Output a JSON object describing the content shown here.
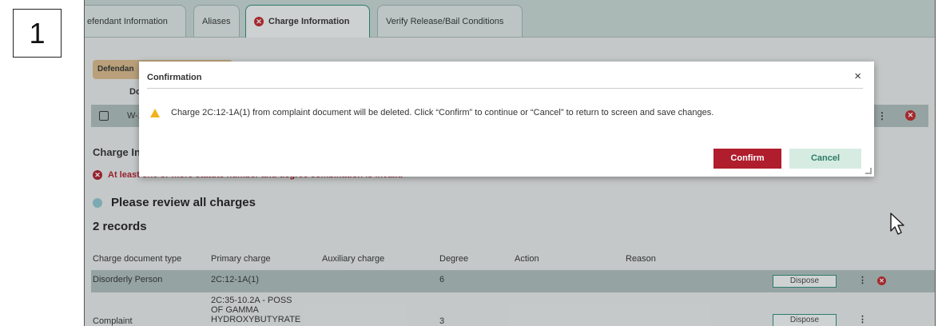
{
  "step_number": "1",
  "tabs": [
    {
      "label": "efendant Information"
    },
    {
      "label": "Aliases"
    },
    {
      "label": "Charge Information"
    },
    {
      "label": "Verify Release/Bail Conditions"
    }
  ],
  "defendant_pill": "Defendan",
  "doc_label": "Do",
  "doc_row_text": "W-2",
  "charge_info_heading": "Charge In",
  "error_message": "At least one or more statute number and degree combination is invalid",
  "review_message": "Please review all charges",
  "records_count": "2 records",
  "table": {
    "headers": [
      "Charge document type",
      "Primary charge",
      "Auxiliary charge",
      "Degree",
      "Action",
      "Reason"
    ],
    "rows": [
      {
        "type": "Disorderly Person",
        "primary": "2C:12-1A(1)",
        "auxiliary": "",
        "degree": "6",
        "action": "",
        "reason": "",
        "button": "Dispose"
      },
      {
        "type": "Complaint",
        "primary_line1": "2C:35-10.2A - POSS",
        "primary_line2": "OF GAMMA",
        "primary_line3": "HYDROXYBUTYRATE",
        "auxiliary": "",
        "degree": "3",
        "action": "",
        "reason": "",
        "button": "Dispose"
      }
    ]
  },
  "modal": {
    "title": "Confirmation",
    "message": "Charge 2C:12-1A(1) from complaint document will be deleted. Click “Confirm” to continue or “Cancel” to return to screen and save changes.",
    "confirm_label": "Confirm",
    "cancel_label": "Cancel",
    "close_glyph": "×"
  },
  "colors": {
    "confirm": "#b01d2d",
    "cancel_bg": "#d6ece3",
    "error": "#b01d2d",
    "tab_active_border": "#2e8b7a"
  }
}
